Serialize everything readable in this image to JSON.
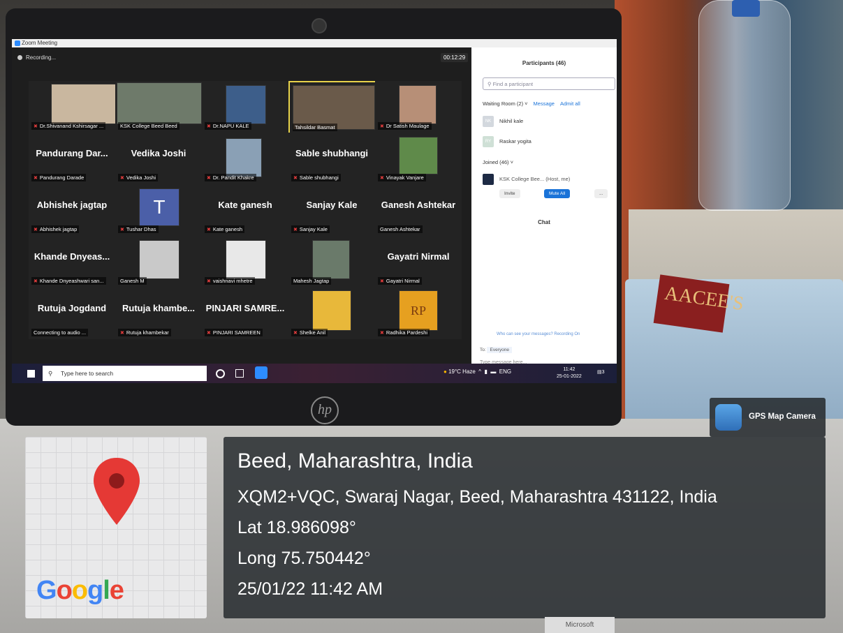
{
  "zoom": {
    "window_title": "Zoom Meeting",
    "recording": "Recording...",
    "timer": "00:12:29",
    "tiles": [
      {
        "name": "",
        "caption": "Dr.Shivanand Kshirsagar ...",
        "muted": true
      },
      {
        "name": "",
        "caption": "KSK College Beed Beed",
        "muted": false
      },
      {
        "name": "",
        "caption": "Dr.NAPU KALE",
        "muted": true
      },
      {
        "name": "",
        "caption": "Tahsildar Basmat",
        "muted": false
      },
      {
        "name": "",
        "caption": "Dr Satish Maulage",
        "muted": true
      },
      {
        "name": "Pandurang Dar...",
        "caption": "Pandurang Darade",
        "muted": true
      },
      {
        "name": "Vedika Joshi",
        "caption": "Vedika Joshi",
        "muted": true
      },
      {
        "name": "",
        "caption": "Dr. Pandit Khakre",
        "muted": true
      },
      {
        "name": "Sable shubhangi",
        "caption": "Sable shubhangi",
        "muted": true
      },
      {
        "name": "",
        "caption": "Vinayak Vanjare",
        "muted": true
      },
      {
        "name": "Abhishek jagtap",
        "caption": "Abhishek jagtap",
        "muted": true
      },
      {
        "name": "",
        "caption": "Tushar Dhas",
        "muted": true
      },
      {
        "name": "Kate ganesh",
        "caption": "Kate ganesh",
        "muted": true
      },
      {
        "name": "Sanjay Kale",
        "caption": "Sanjay Kale",
        "muted": true
      },
      {
        "name": "Ganesh Ashtekar",
        "caption": "Ganesh Ashtekar",
        "muted": false
      },
      {
        "name": "Khande  Dnyeas...",
        "caption": "Khande Dnyeashwari san...",
        "muted": true
      },
      {
        "name": "",
        "caption": "Ganesh M",
        "muted": false
      },
      {
        "name": "",
        "caption": "vaishnavi mhetre",
        "muted": true
      },
      {
        "name": "",
        "caption": "Mahesh Jagtap",
        "muted": false
      },
      {
        "name": "Gayatri Nirmal",
        "caption": "Gayatri Nirmal",
        "muted": true
      },
      {
        "name": "Rutuja Jogdand",
        "caption": "Connecting to audio ...",
        "muted": false
      },
      {
        "name": "Rutuja  khambe...",
        "caption": "Rutuja khambekar",
        "muted": true
      },
      {
        "name": "PINJARI  SAMRE...",
        "caption": "PINJARI SAMREEN",
        "muted": true
      },
      {
        "name": "",
        "caption": "Shelke Anil",
        "muted": true
      },
      {
        "name": "",
        "caption": "Radhika Pardeshi",
        "muted": true
      }
    ],
    "avatar_letters": {
      "t": "T",
      "rp": "RP"
    },
    "panel": {
      "participants_title": "Participants (46)",
      "find_placeholder": "Find a participant",
      "waiting_room": "Waiting Room (2)",
      "message_label": "Message",
      "admit_all_label": "Admit all",
      "waiting": [
        {
          "initials": "NK",
          "name": "Nikhil kale"
        },
        {
          "initials": "RY",
          "name": "Raskar yogita"
        }
      ],
      "joined": "Joined (46)",
      "host": "KSK College Bee...  (Host, me)",
      "invite_label": "Invite",
      "mute_all_label": "Mute All",
      "more_label": "...",
      "chat_title": "Chat",
      "who_can_see": "Who can see your messages? Recording On",
      "to_label": "To:",
      "to_value": "Everyone",
      "message_placeholder": "Type message here..."
    }
  },
  "taskbar": {
    "search_placeholder": "Type here to search",
    "weather": "19°C  Haze",
    "lang": "ENG",
    "time": "11:42",
    "date": "25-01-2022",
    "notif_count": "3"
  },
  "gps": {
    "app_name": "GPS Map Camera",
    "map_brand": "Google",
    "place": "Beed, Maharashtra, India",
    "address": "XQM2+VQC, Swaraj Nagar, Beed, Maharashtra 431122, India",
    "lat": "Lat 18.986098°",
    "long": "Long 75.750442°",
    "datetime": "25/01/22 11:42 AM"
  },
  "scene": {
    "hp_logo": "hp",
    "book_text": "AACEE'S",
    "brand_keyboard": "Microsoft"
  }
}
